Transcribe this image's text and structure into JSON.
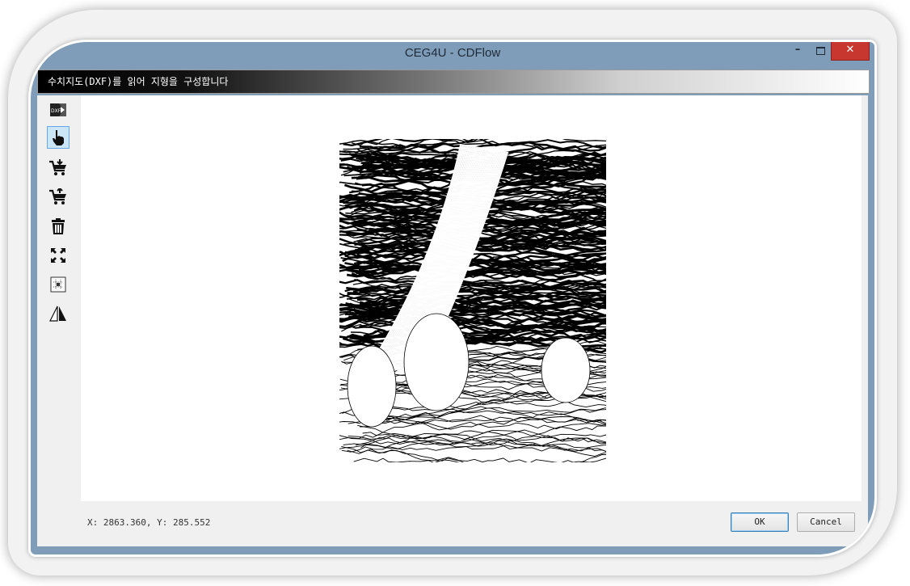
{
  "window": {
    "title": "CEG4U - CDFlow",
    "minimize_glyph": "–",
    "close_glyph": "✕"
  },
  "banner": {
    "text": "수치지도(DXF)를 읽어 지형을 구성합니다"
  },
  "toolbar": {
    "items": [
      {
        "name": "open-dxf",
        "label": "DXF",
        "icon": "dxf-file-icon"
      },
      {
        "name": "pan",
        "icon": "hand-pointer-icon",
        "active": true
      },
      {
        "name": "add-down",
        "icon": "cart-add-icon"
      },
      {
        "name": "add-up",
        "icon": "cart-add-icon"
      },
      {
        "name": "delete",
        "icon": "trash-icon"
      },
      {
        "name": "fit",
        "icon": "expand-icon"
      },
      {
        "name": "grid",
        "icon": "grid-select-icon"
      },
      {
        "name": "mirror",
        "icon": "mirror-triangle-icon"
      }
    ]
  },
  "status": {
    "coords": "X: 2863.360, Y: 285.552"
  },
  "buttons": {
    "ok": "OK",
    "cancel": "Cancel"
  },
  "colors": {
    "window_frame": "#7f9db9",
    "close_button": "#c7372f",
    "active_tool": "#cde6f7"
  }
}
